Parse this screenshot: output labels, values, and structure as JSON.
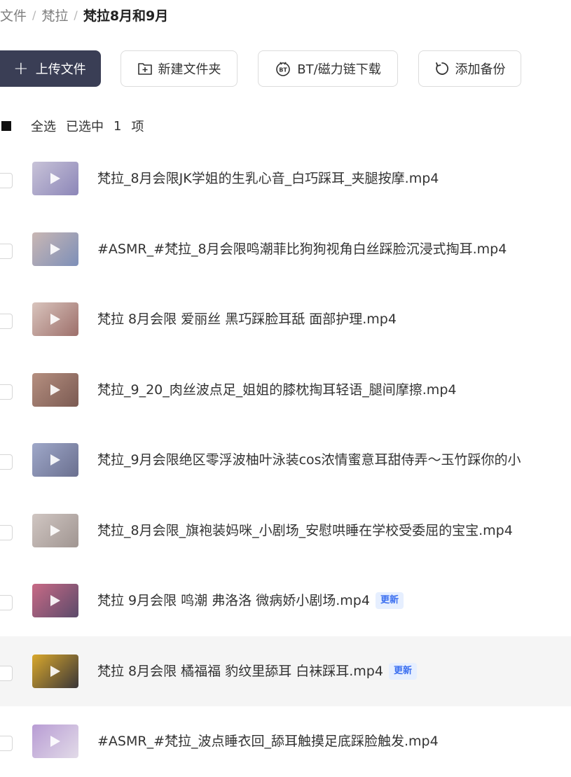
{
  "breadcrumb": {
    "items": [
      "文件",
      "梵拉"
    ],
    "separator": "/",
    "current": "梵拉8月和9月"
  },
  "toolbar": {
    "upload_label": "上传文件",
    "new_folder_label": "新建文件夹",
    "bt_label": "BT/磁力链下载",
    "backup_label": "添加备份"
  },
  "selection": {
    "select_all_label": "全选",
    "selected_prefix": "已选中",
    "selected_count": "1",
    "selected_suffix": "项"
  },
  "colors": {
    "primary_button": "#3a3e55",
    "badge_bg": "#e6efff",
    "badge_text": "#3b6ff0"
  },
  "files": [
    {
      "name": "梵拉_8月会限JK学姐的生乳心音_白巧踩耳_夹腿按摩.mp4",
      "badge": "",
      "thumb_colors": [
        "#c8c3d8",
        "#8c86b8"
      ]
    },
    {
      "name": "#ASMR_#梵拉_8月会限鸣潮菲比狗狗视角白丝踩脸沉浸式掏耳.mp4",
      "badge": "",
      "thumb_colors": [
        "#c9b7b4",
        "#7d8fb8"
      ]
    },
    {
      "name": "梵拉 8月会限 爱丽丝 黑巧踩脸耳舐 面部护理.mp4",
      "badge": "",
      "thumb_colors": [
        "#d9c4bd",
        "#9d6f6a"
      ]
    },
    {
      "name": "梵拉_9_20_肉丝波点足_姐姐的膝枕掏耳轻语_腿间摩擦.mp4",
      "badge": "",
      "thumb_colors": [
        "#b58f80",
        "#7b5a52"
      ]
    },
    {
      "name": "梵拉_9月会限绝区零浮波柚叶泳装cos浓情蜜意耳甜侍弄～玉竹踩你的小",
      "badge": "",
      "thumb_colors": [
        "#9fa8c9",
        "#6a6f8f"
      ]
    },
    {
      "name": "梵拉_8月会限_旗袍装妈咪_小剧场_安慰哄睡在学校受委屈的宝宝.mp4",
      "badge": "",
      "thumb_colors": [
        "#d0c6c2",
        "#a09591"
      ]
    },
    {
      "name": "梵拉 9月会限 鸣潮 弗洛洛 微病娇小剧场.mp4",
      "badge": "更新",
      "thumb_colors": [
        "#c86a86",
        "#5b4a6a"
      ]
    },
    {
      "name": "梵拉 8月会限 橘福福 豹纹里舔耳 白袜踩耳.mp4",
      "badge": "更新",
      "thumb_colors": [
        "#d9a82c",
        "#3a3638"
      ]
    },
    {
      "name": "#ASMR_#梵拉_波点睡衣回_舔耳触摸足底踩脸触发.mp4",
      "badge": "",
      "thumb_colors": [
        "#b89cd4",
        "#e2dbe8"
      ]
    }
  ]
}
